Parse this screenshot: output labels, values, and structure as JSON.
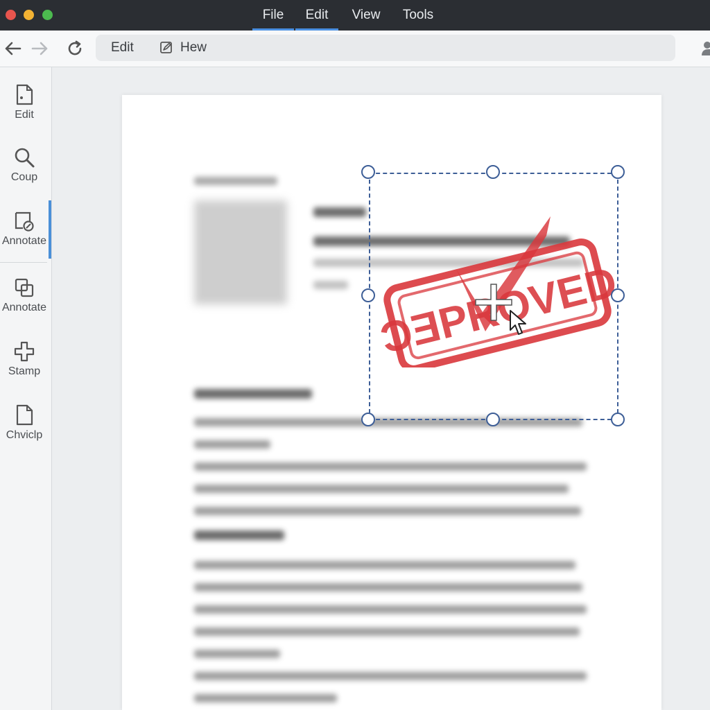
{
  "window": {
    "menus": [
      {
        "label": "File",
        "active": true
      },
      {
        "label": "Edit",
        "active": true
      },
      {
        "label": "View",
        "active": false
      },
      {
        "label": "Tools",
        "active": false
      }
    ]
  },
  "toolbar": {
    "breadcrumb": [
      {
        "label": "Edit"
      },
      {
        "label": "Hew",
        "icon": "edit-document-icon"
      }
    ]
  },
  "sidebar": {
    "items": [
      {
        "label": "Edit",
        "icon": "document-edit-icon"
      },
      {
        "label": "Coup",
        "icon": "magnifier-icon"
      },
      {
        "label": "Annotate",
        "icon": "annotate-icon",
        "active": true
      },
      {
        "label": "Annotate",
        "icon": "layers-icon"
      },
      {
        "label": "Stamp",
        "icon": "plus-icon"
      },
      {
        "label": "Chviclp",
        "icon": "blank-document-icon"
      }
    ]
  },
  "stamp": {
    "text": "ƆƎPROVED",
    "color": "#d9373c"
  },
  "colors": {
    "accent": "#4a90e2",
    "selection": "#3d5e97"
  }
}
